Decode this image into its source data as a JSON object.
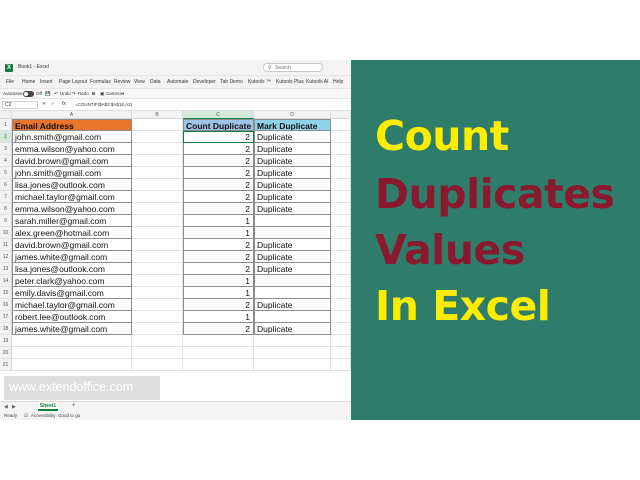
{
  "window": {
    "title": "Book1 - Excel",
    "logo_letter": "X",
    "search_placeholder": "Search"
  },
  "menu": [
    "File",
    "Home",
    "Insert",
    "Page Layout",
    "Formulas",
    "Review",
    "View",
    "Data",
    "Automate",
    "Developer",
    "Tab Demo",
    "Kutools ™",
    "Kutools Plus",
    "Kutools AI",
    "Help"
  ],
  "toolbar": {
    "autosave": "AutoSave",
    "toggle_state": "Off",
    "undo": "Undo",
    "redo": "Redo",
    "bold": "B",
    "camera": "Camera"
  },
  "formula_bar": {
    "name_box": "C2",
    "fx": "fx",
    "formula": "=COUNTIF($A$2:$A$18,A2)"
  },
  "columns": [
    "A",
    "B",
    "C",
    "D"
  ],
  "headers": {
    "email": "Email Address",
    "count": "Count Duplicate",
    "mark": "Mark Duplicate"
  },
  "rows": [
    {
      "email": "john.smith@gmail.com",
      "count": "2",
      "mark": "Duplicate"
    },
    {
      "email": "emma.wilson@yahoo.com",
      "count": "2",
      "mark": "Duplicate"
    },
    {
      "email": "david.brown@gmail.com",
      "count": "2",
      "mark": "Duplicate"
    },
    {
      "email": "john.smith@gmail.com",
      "count": "2",
      "mark": "Duplicate"
    },
    {
      "email": "lisa.jones@outlook.com",
      "count": "2",
      "mark": "Duplicate"
    },
    {
      "email": "michael.taylor@gmail.com",
      "count": "2",
      "mark": "Duplicate"
    },
    {
      "email": "emma.wilson@yahoo.com",
      "count": "2",
      "mark": "Duplicate"
    },
    {
      "email": "sarah.miller@gmail.com",
      "count": "1",
      "mark": ""
    },
    {
      "email": "alex.green@hotmail.com",
      "count": "1",
      "mark": ""
    },
    {
      "email": "david.brown@gmail.com",
      "count": "2",
      "mark": "Duplicate"
    },
    {
      "email": "james.white@gmail.com",
      "count": "2",
      "mark": "Duplicate"
    },
    {
      "email": "lisa.jones@outlook.com",
      "count": "2",
      "mark": "Duplicate"
    },
    {
      "email": "peter.clark@yahoo.com",
      "count": "1",
      "mark": ""
    },
    {
      "email": "emily.davis@gmail.com",
      "count": "1",
      "mark": ""
    },
    {
      "email": "michael.taylor@gmail.com",
      "count": "2",
      "mark": "Duplicate"
    },
    {
      "email": "robert.lee@outlook.com",
      "count": "1",
      "mark": ""
    },
    {
      "email": "james.white@gmail.com",
      "count": "2",
      "mark": "Duplicate"
    }
  ],
  "row_numbers": [
    "1",
    "2",
    "3",
    "4",
    "5",
    "6",
    "7",
    "8",
    "9",
    "10",
    "11",
    "12",
    "13",
    "14",
    "15",
    "16",
    "17",
    "18",
    "19",
    "20",
    "21"
  ],
  "watermark": "www.extendoffice.com",
  "sheet": {
    "tab": "Sheet1",
    "add": "+"
  },
  "status": {
    "ready": "Ready",
    "accessibility": "Accessibility: Good to go"
  },
  "banner": {
    "line1": "Count",
    "line2": "Duplicates",
    "line3": "Values",
    "line4": "In Excel"
  },
  "colors": {
    "panel": "#2e7d6b",
    "yellow": "#ffed00",
    "maroon": "#8a1930",
    "email_header": "#e9742b",
    "count_header": "#9dc3e6",
    "mark_header": "#8fd3e8",
    "excel_green": "#107c41"
  }
}
